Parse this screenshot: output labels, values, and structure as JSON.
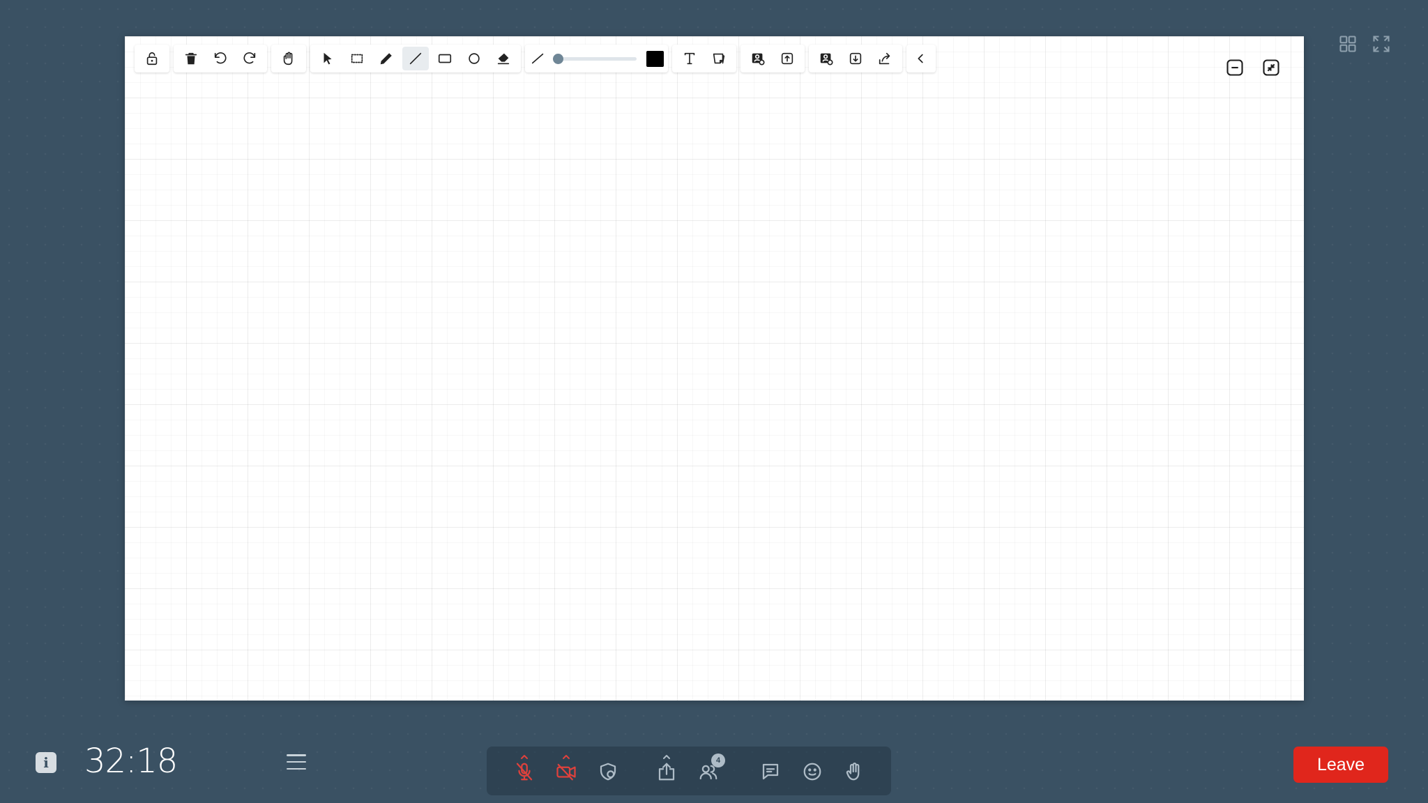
{
  "top_right": {
    "grid_view_icon": "grid-icon",
    "fullscreen_icon": "fullscreen-icon"
  },
  "whiteboard": {
    "toolbar": [
      "lock-icon",
      "trash-icon",
      "undo-icon",
      "redo-icon",
      "hand-icon",
      "pointer-icon",
      "select-box-icon",
      "pencil-icon",
      "line-icon",
      "rectangle-icon",
      "circle-icon",
      "eraser-icon",
      "stroke-width-icon",
      "stroke-color-icon",
      "text-icon",
      "sticky-note-icon",
      "save-image-icon",
      "upload-icon",
      "load-image-icon",
      "download-icon",
      "share-icon",
      "collapse-icon"
    ],
    "active_tool": "line",
    "stroke_width": 0.0,
    "stroke_color": "#000000",
    "board_controls": [
      "minimize-icon",
      "exit-fullscreen-icon"
    ]
  },
  "footer": {
    "info_label": "i",
    "timer": "32:18",
    "participants_count": "4",
    "leave_label": "Leave"
  },
  "colors": {
    "background": "#3a5163",
    "leave": "#e0261c",
    "muted": "#e0413c"
  }
}
